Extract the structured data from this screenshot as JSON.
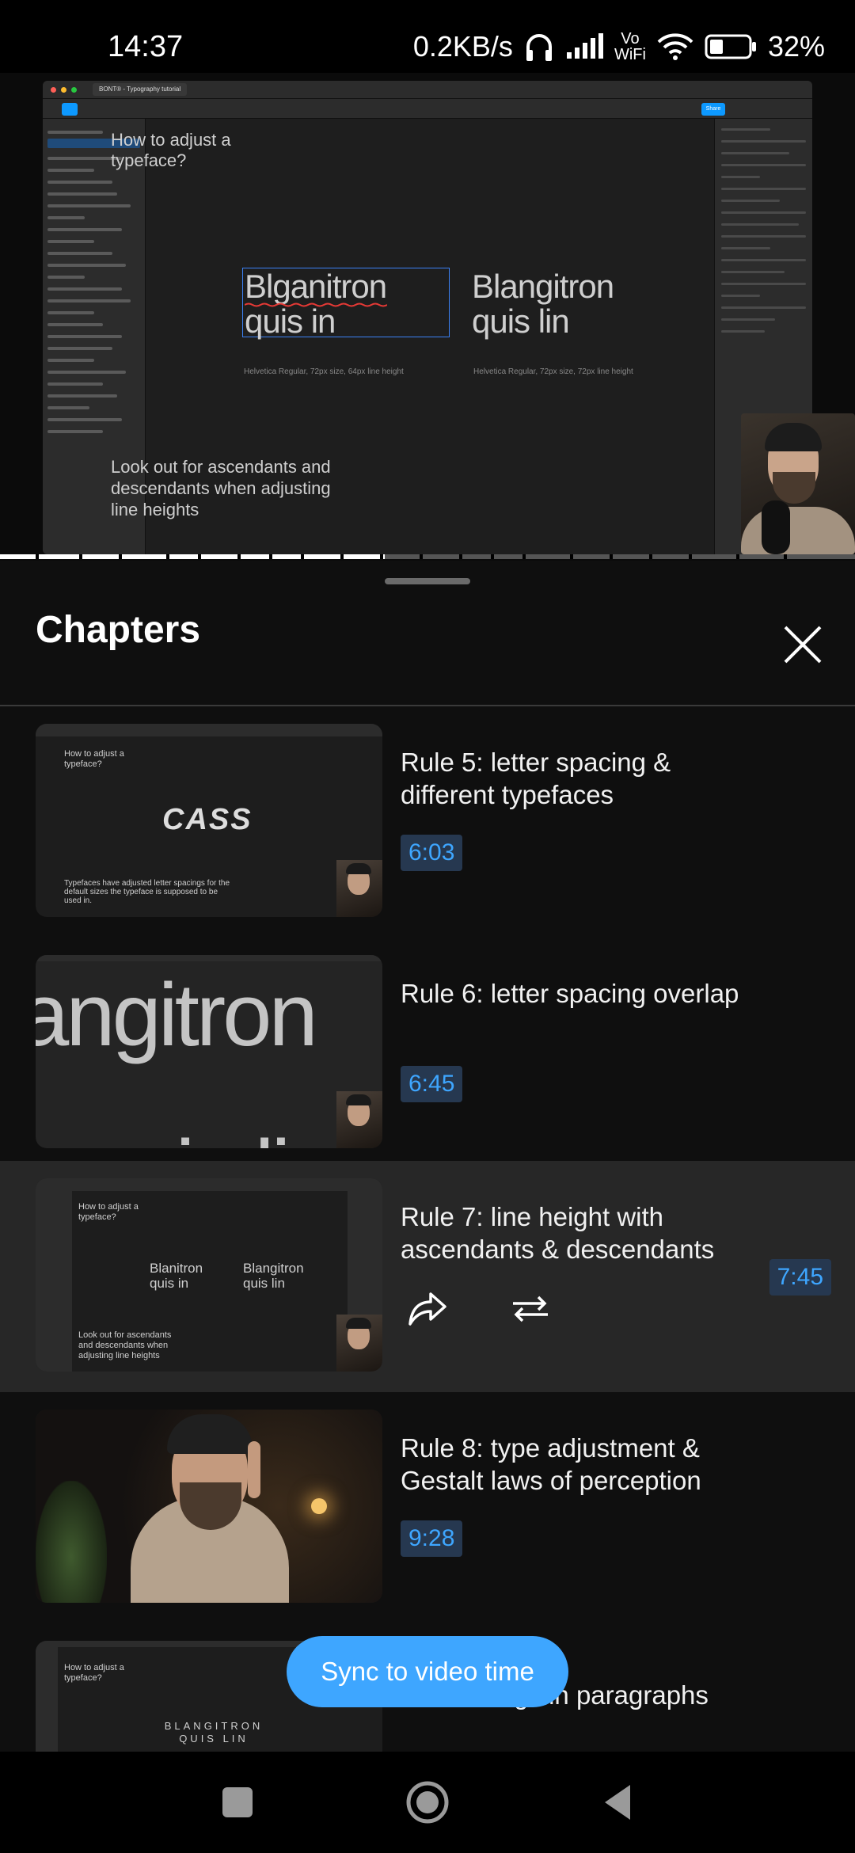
{
  "status_bar": {
    "time": "14:37",
    "speed": "0.2KB/s",
    "vowifi": "Vo WiFi",
    "battery": "32%",
    "icons": [
      "headphones-icon",
      "signal-icon",
      "vowifi-icon",
      "wifi-icon",
      "battery-icon"
    ]
  },
  "video": {
    "tab_title": "BONT® - Typography tutorial",
    "share_label": "Share",
    "canvas_heading": "How to adjust a typeface?",
    "sample_left": "Blganitron quis in",
    "sample_right": "Blangitron quis lin",
    "caption_left": "Helvetica Regular, 72px size, 64px line height",
    "caption_right": "Helvetica Regular, 72px size, 72px line height",
    "canvas_note": "Look out for ascendants and descendants when adjusting line heights"
  },
  "sheet": {
    "title": "Chapters",
    "chapters": [
      {
        "title": "Rule 5: letter spacing & different typefaces",
        "time": "6:03",
        "thumb_heading": "How to adjust a typeface?",
        "thumb_word": "CASS",
        "thumb_note": "Typefaces have adjusted letter spacings for the default sizes the typeface is supposed to be used in."
      },
      {
        "title": "Rule 6: letter spacing overlap",
        "time": "6:45",
        "thumb_word": "angitron",
        "thumb_word2": "quis lin"
      },
      {
        "title": "Rule 7: line height with ascendants & descendants",
        "time": "7:45",
        "thumb_heading": "How to adjust a typeface?",
        "thumb_left": "Blanitron quis in",
        "thumb_right": "Blangitron quis lin",
        "thumb_note": "Look out for ascendants and descendants when adjusting line heights"
      },
      {
        "title": "Rule 8: type adjustment & Gestalt laws of perception",
        "time": "9:28"
      },
      {
        "title": "Rule 9: rags in paragraphs",
        "thumb_heading": "How to adjust a typeface?",
        "thumb_word": "BLANGITRON QUIS LIN"
      }
    ]
  },
  "sync_button": "Sync to video time",
  "navbar": {
    "icons": [
      "recents-square-icon",
      "home-circle-icon",
      "back-triangle-icon"
    ]
  },
  "colors": {
    "accent": "#3ea6ff",
    "timestamp_bg": "#263850",
    "active_row": "#272727",
    "sheet_bg": "#0f0f0f"
  },
  "progress": {
    "played_fraction": 0.45
  }
}
